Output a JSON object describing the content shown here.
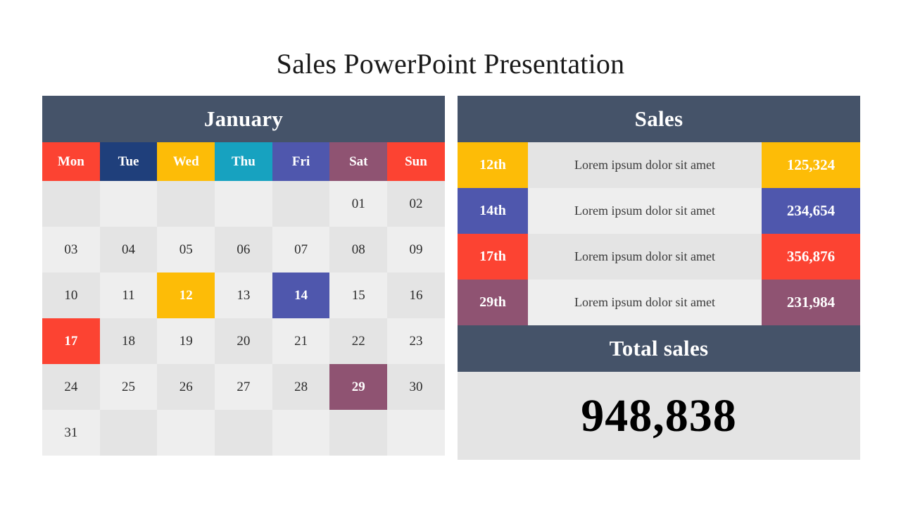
{
  "slide": {
    "title": "Sales PowerPoint Presentation",
    "background": "#FFFFFF"
  },
  "palette": {
    "header_slate": "#455369",
    "red": "#FC4332",
    "navy": "#1F3F7B",
    "amber": "#FDBC07",
    "teal": "#17A2C0",
    "indigo": "#4F57AD",
    "plum": "#8F5372",
    "cell_dark": "#E4E4E4",
    "cell_light": "#EEEEEE",
    "text_dark": "#2B2B2B",
    "text_white": "#FFFFFF"
  },
  "calendar": {
    "title": "January",
    "daynames": [
      {
        "label": "Mon",
        "color": "#FC4332"
      },
      {
        "label": "Tue",
        "color": "#1F3F7B"
      },
      {
        "label": "Wed",
        "color": "#FDBC07"
      },
      {
        "label": "Thu",
        "color": "#17A2C0"
      },
      {
        "label": "Fri",
        "color": "#4F57AD"
      },
      {
        "label": "Sat",
        "color": "#8F5372"
      },
      {
        "label": "Sun",
        "color": "#FC4332"
      }
    ],
    "weeks": [
      [
        {
          "label": "",
          "highlight": null
        },
        {
          "label": "",
          "highlight": null
        },
        {
          "label": "",
          "highlight": null
        },
        {
          "label": "",
          "highlight": null
        },
        {
          "label": "",
          "highlight": null
        },
        {
          "label": "01",
          "highlight": null
        },
        {
          "label": "02",
          "highlight": null
        }
      ],
      [
        {
          "label": "03",
          "highlight": null
        },
        {
          "label": "04",
          "highlight": null
        },
        {
          "label": "05",
          "highlight": null
        },
        {
          "label": "06",
          "highlight": null
        },
        {
          "label": "07",
          "highlight": null
        },
        {
          "label": "08",
          "highlight": null
        },
        {
          "label": "09",
          "highlight": null
        }
      ],
      [
        {
          "label": "10",
          "highlight": null
        },
        {
          "label": "11",
          "highlight": null
        },
        {
          "label": "12",
          "highlight": "#FDBC07"
        },
        {
          "label": "13",
          "highlight": null
        },
        {
          "label": "14",
          "highlight": "#4F57AD"
        },
        {
          "label": "15",
          "highlight": null
        },
        {
          "label": "16",
          "highlight": null
        }
      ],
      [
        {
          "label": "17",
          "highlight": "#FC4332"
        },
        {
          "label": "18",
          "highlight": null
        },
        {
          "label": "19",
          "highlight": null
        },
        {
          "label": "20",
          "highlight": null
        },
        {
          "label": "21",
          "highlight": null
        },
        {
          "label": "22",
          "highlight": null
        },
        {
          "label": "23",
          "highlight": null
        }
      ],
      [
        {
          "label": "24",
          "highlight": null
        },
        {
          "label": "25",
          "highlight": null
        },
        {
          "label": "26",
          "highlight": null
        },
        {
          "label": "27",
          "highlight": null
        },
        {
          "label": "28",
          "highlight": null
        },
        {
          "label": "29",
          "highlight": "#8F5372"
        },
        {
          "label": "30",
          "highlight": null
        }
      ],
      [
        {
          "label": "31",
          "highlight": null
        },
        {
          "label": "",
          "highlight": null
        },
        {
          "label": "",
          "highlight": null
        },
        {
          "label": "",
          "highlight": null
        },
        {
          "label": "",
          "highlight": null
        },
        {
          "label": "",
          "highlight": null
        },
        {
          "label": "",
          "highlight": null
        }
      ]
    ]
  },
  "sales": {
    "title": "Sales",
    "rows": [
      {
        "date": "12th",
        "description": "Lorem ipsum dolor sit amet",
        "amount": "125,324",
        "color": "#FDBC07"
      },
      {
        "date": "14th",
        "description": "Lorem ipsum dolor sit amet",
        "amount": "234,654",
        "color": "#4F57AD"
      },
      {
        "date": "17th",
        "description": "Lorem ipsum dolor sit amet",
        "amount": "356,876",
        "color": "#FC4332"
      },
      {
        "date": "29th",
        "description": "Lorem ipsum dolor sit amet",
        "amount": "231,984",
        "color": "#8F5372"
      }
    ],
    "total_label": "Total sales",
    "total_value": "948,838"
  }
}
